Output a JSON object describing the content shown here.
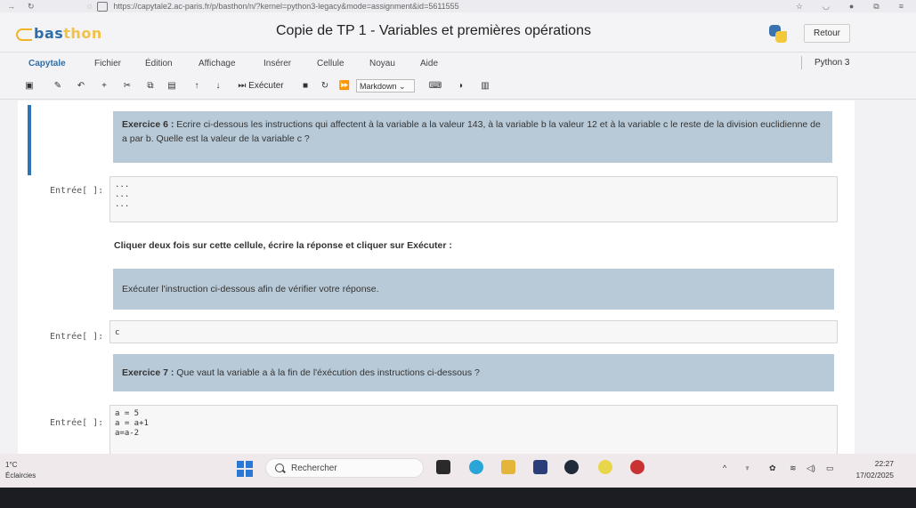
{
  "browser": {
    "url": "https://capytale2.ac-paris.fr/p/basthon/n/?kernel=python3-legacy&mode=assignment&id=5611555"
  },
  "header": {
    "logo_bas": "bas",
    "logo_thon": "thon",
    "title": "Copie de TP 1 - Variables et premières opérations",
    "retour": "Retour"
  },
  "menu": {
    "brand": "Capytale",
    "items": [
      "Fichier",
      "Édition",
      "Affichage",
      "Insérer",
      "Cellule",
      "Noyau",
      "Aide"
    ],
    "kernel": "Python 3"
  },
  "toolbar": {
    "run_label": "Exécuter",
    "cell_type": "Markdown"
  },
  "cells": {
    "ex6_label": "Exercice 6 :",
    "ex6_text": " Ecrire ci-dessous les instructions qui affectent à la variable a la valeur 143, à la variable b la valeur 12 et à la variable c le reste de la division euclidienne de a par b. Quelle est la valeur de la variable c ?",
    "prompt1": "Entrée[ ]:",
    "code1": [
      "...",
      "...",
      "..."
    ],
    "instruction": "Cliquer deux fois sur cette cellule, écrire la réponse et cliquer sur Exécuter :",
    "verify": "Exécuter l'instruction ci-dessous afin de vérifier votre réponse.",
    "prompt2": "Entrée[ ]:",
    "code2": "c",
    "ex7_label": "Exercice 7 :",
    "ex7_text": " Que vaut la variable a à la fin de l'éxécution des instructions ci-dessous ?",
    "prompt3": "Entrée[ ]:",
    "code3": [
      "a = 5",
      "a = a+1",
      "a=a-2"
    ]
  },
  "taskbar": {
    "temp": "1°C",
    "weather": "Éclaircies",
    "search": "Rechercher",
    "time": "22:27",
    "date": "17/02/2025"
  }
}
